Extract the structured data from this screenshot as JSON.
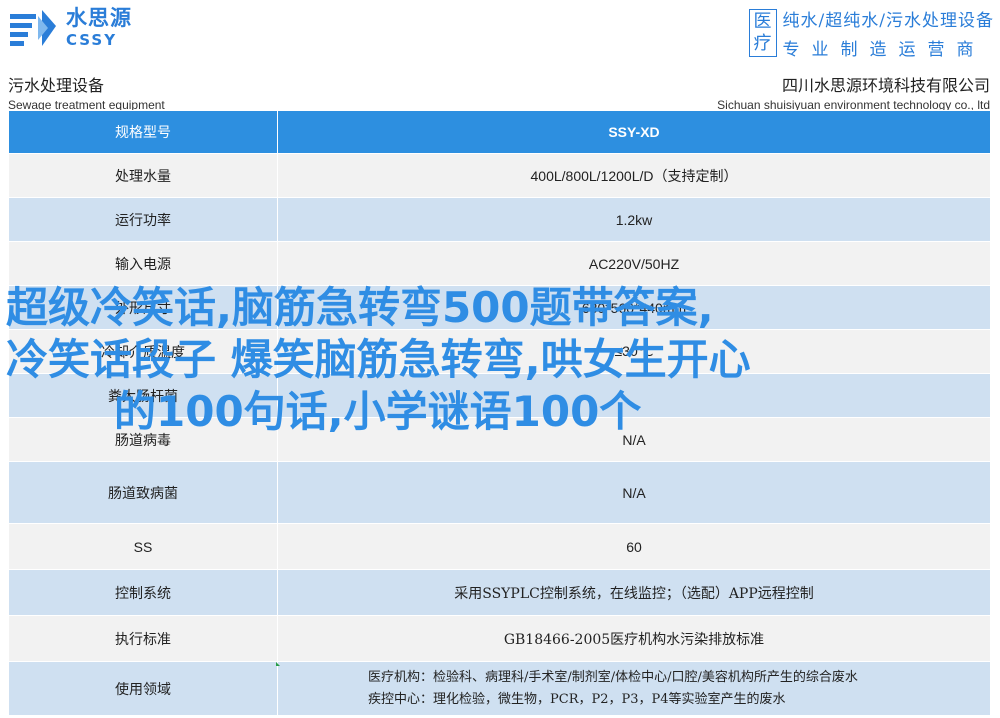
{
  "brand": {
    "name_cn": "水思源",
    "name_en": "CSSY",
    "accent": "#2a7dd8"
  },
  "slogan": {
    "box": "医疗",
    "line1": "纯水/超纯水/污水处理设备",
    "line2": "专业制造运营商"
  },
  "subheader": {
    "left_cn": "污水处理设备",
    "left_en": "Sewage treatment equipment",
    "right_cn": "四川水思源环境科技有限公司",
    "right_en": "Sichuan shuisiyuan environment technology co., ltd"
  },
  "table": {
    "header": {
      "label": "规格型号",
      "value": "SSY-XD"
    },
    "rows": [
      {
        "label": "处理水量",
        "value": "400L/800L/1200L/D（支持定制）"
      },
      {
        "label": "运行功率",
        "value": "1.2kw"
      },
      {
        "label": "输入电源",
        "value": "AC220V/50HZ"
      },
      {
        "label": "外形尺寸",
        "value": "630*560*440mm"
      },
      {
        "label": "冷却介质温度",
        "value": "≤30℃"
      },
      {
        "label": "粪大肠杆菌",
        "value": ""
      },
      {
        "label": "肠道病毒",
        "value": "N/A"
      },
      {
        "label": "肠道致病菌",
        "value": "N/A"
      },
      {
        "label": "SS",
        "value": "60"
      },
      {
        "label": "控制系统",
        "value": "采用SSYPLC控制系统，在线监控；（选配）APP远程控制"
      },
      {
        "label": "执行标准",
        "value": "GB18466-2005医疗机构水污染排放标准"
      },
      {
        "label": "使用领域",
        "value_line1": "医疗机构：检验科、病理科/手术室/制剂室/体检中心/口腔/美容机构所产生的综合废水",
        "value_line2": "疾控中心：理化检验，微生物，PCR，P2，P3，P4等实验室产生的废水"
      }
    ]
  },
  "overlay": {
    "line1": "超级冷笑话,脑筋急转弯500题带答案,",
    "line2": "冷笑话段子 爆笑脑筋急转弯,哄女生开心",
    "line3": "的100句话,小学谜语100个"
  }
}
